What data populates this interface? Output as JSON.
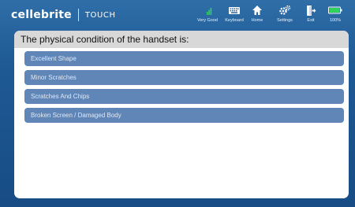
{
  "app": {
    "brand_name": "cellebrite",
    "product_name": "TOUCH"
  },
  "toolbar": {
    "signal_label": "Very Good",
    "keyboard_label": "Keyboard",
    "home_label": "Home",
    "settings_label": "Settings",
    "exit_label": "Exit",
    "battery_label": "100%",
    "battery_level": 1.0
  },
  "panel": {
    "question": "The physical condition of the handset is:",
    "options": [
      {
        "label": "Excellent Shape"
      },
      {
        "label": "Minor Scratches"
      },
      {
        "label": "Scratches And Chips"
      },
      {
        "label": "Broken Screen / Damaged Body"
      }
    ]
  },
  "colors": {
    "frame": "#1f5a95",
    "option": "#5f86b6",
    "header": "#d8d8d8",
    "battery": "#2fd35a"
  },
  "icons": [
    "signal-icon",
    "keyboard-icon",
    "home-icon",
    "settings-icon",
    "exit-icon",
    "battery-icon"
  ]
}
